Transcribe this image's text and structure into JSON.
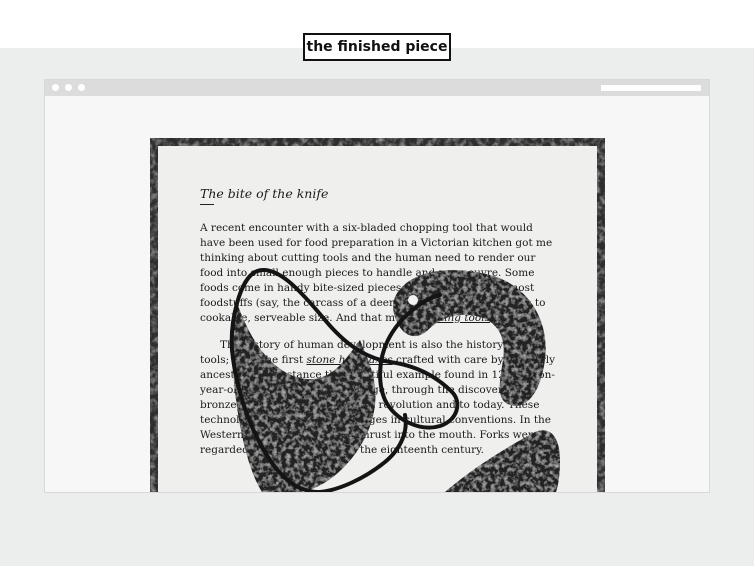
{
  "caption": "the finished piece",
  "article": {
    "title": "The bite of the knife",
    "paragraphs": [
      {
        "before": "A recent encounter with a six-bladed chopping tool that would have been used for food preparation in a Victorian kitchen got me thinking about cutting tools and the human need to render our food into small enough pieces to handle and manoeuvre. Some foods come in handy bite-sized pieces (berries, nuts), but most foodstuffs (say, the carcass of a deer) it is necessary to reduce to cookable, serveable size. And that means ",
        "link": "cutting tools",
        "after": "."
      },
      {
        "before": "The history of human development is also the history of our tools; from the first ",
        "link": "stone hand-axes",
        "after": " crafted with care by our early ancestors, for instance the beautiful example found in 120 million-year-old deposits of Olduvai Gorge, through the discovery of bronze, iron, steel, the industrial revolution and to today. These technologies have marked changes in cultural conventions. In the Western world, the knife was thrust into the mouth. Forks were regarded with suspicion until the eighteenth century."
      }
    ]
  },
  "colors": {
    "band": "#eceeed",
    "paper": "#efefed",
    "ink": "#1b1b1b",
    "shape": "#222222"
  }
}
